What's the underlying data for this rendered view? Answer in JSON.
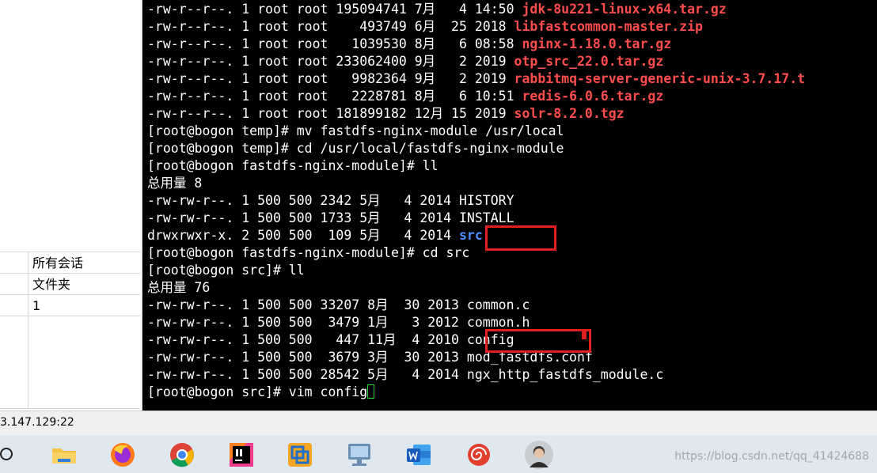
{
  "left_panel": {
    "properties": [
      {
        "value": "所有会话"
      },
      {
        "value": "文件夹"
      },
      {
        "value": "1"
      },
      {
        "value": ""
      }
    ]
  },
  "terminal": {
    "lines": [
      [
        {
          "t": "-rw-r--r--. 1 root root 195094741 7月   4 14:50 "
        },
        {
          "t": "jdk-8u221-linux-x64.tar.gz",
          "c": "red"
        }
      ],
      [
        {
          "t": "-rw-r--r--. 1 root root    493749 6月  25 2018 "
        },
        {
          "t": "libfastcommon-master.zip",
          "c": "red"
        }
      ],
      [
        {
          "t": "-rw-r--r--. 1 root root   1039530 8月   6 08:58 "
        },
        {
          "t": "nginx-1.18.0.tar.gz",
          "c": "red"
        }
      ],
      [
        {
          "t": "-rw-r--r--. 1 root root 233062400 9月   2 2019 "
        },
        {
          "t": "otp_src_22.0.tar.gz",
          "c": "red"
        }
      ],
      [
        {
          "t": "-rw-r--r--. 1 root root   9982364 9月   2 2019 "
        },
        {
          "t": "rabbitmq-server-generic-unix-3.7.17.t",
          "c": "red"
        }
      ],
      [
        {
          "t": "-rw-r--r--. 1 root root   2228781 8月   6 10:51 "
        },
        {
          "t": "redis-6.0.6.tar.gz",
          "c": "red"
        }
      ],
      [
        {
          "t": "-rw-r--r--. 1 root root 181899182 12月 15 2019 "
        },
        {
          "t": "solr-8.2.0.tgz",
          "c": "red"
        }
      ],
      [
        {
          "t": "[root@bogon temp]# mv fastdfs-nginx-module /usr/local"
        }
      ],
      [
        {
          "t": "[root@bogon temp]# cd /usr/local/fastdfs-nginx-module"
        }
      ],
      [
        {
          "t": "[root@bogon fastdfs-nginx-module]# ll"
        }
      ],
      [
        {
          "t": "总用量 8"
        }
      ],
      [
        {
          "t": "-rw-rw-r--. 1 500 500 2342 5月   4 2014 HISTORY"
        }
      ],
      [
        {
          "t": "-rw-rw-r--. 1 500 500 1733 5月   4 2014 INSTALL"
        }
      ],
      [
        {
          "t": "drwxrwxr-x. 2 500 500  109 5月   4 2014 "
        },
        {
          "t": "src",
          "c": "blue"
        }
      ],
      [
        {
          "t": "[root@bogon fastdfs-nginx-module]# cd src"
        }
      ],
      [
        {
          "t": "[root@bogon src]# ll"
        }
      ],
      [
        {
          "t": "总用量 76"
        }
      ],
      [
        {
          "t": "-rw-rw-r--. 1 500 500 33207 8月  30 2013 common.c"
        }
      ],
      [
        {
          "t": "-rw-rw-r--. 1 500 500  3479 1月   3 2012 common.h"
        }
      ],
      [
        {
          "t": "-rw-rw-r--. 1 500 500   447 11月  4 2010 config"
        }
      ],
      [
        {
          "t": "-rw-rw-r--. 1 500 500  3679 3月  30 2013 mod_fastdfs.conf"
        }
      ],
      [
        {
          "t": "-rw-rw-r--. 1 500 500 28542 5月   4 2014 ngx_http_fastdfs_module.c"
        }
      ],
      [
        {
          "t": "[root@bogon src]# vim config"
        },
        {
          "cursor": true
        }
      ]
    ],
    "highlight_color": "#e02020"
  },
  "status_bar": {
    "text": "3.147.129:22"
  },
  "taskbar": {
    "icons": [
      {
        "name": "file-explorer-icon"
      },
      {
        "name": "firefox-icon"
      },
      {
        "name": "chrome-icon"
      },
      {
        "name": "intellij-idea-icon"
      },
      {
        "name": "remote-session-icon"
      },
      {
        "name": "vm-monitor-icon"
      },
      {
        "name": "word-icon"
      },
      {
        "name": "spiral-app-icon"
      },
      {
        "name": "user-avatar-icon"
      }
    ],
    "watermark": "https://blog.csdn.net/qq_41424688"
  }
}
